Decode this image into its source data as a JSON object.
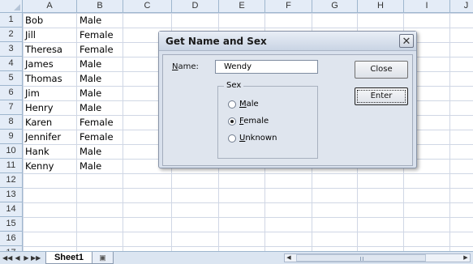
{
  "sheet": {
    "columns": [
      "A",
      "B",
      "C",
      "D",
      "E",
      "F",
      "G",
      "H",
      "I",
      "J"
    ],
    "rows": [
      "1",
      "2",
      "3",
      "4",
      "5",
      "6",
      "7",
      "8",
      "9",
      "10",
      "11",
      "12",
      "13",
      "14",
      "15",
      "16",
      "17"
    ],
    "data": [
      [
        "Bob",
        "Male"
      ],
      [
        "Jill",
        "Female"
      ],
      [
        "Theresa",
        "Female"
      ],
      [
        "James",
        "Male"
      ],
      [
        "Thomas",
        "Male"
      ],
      [
        "Jim",
        "Male"
      ],
      [
        "Henry",
        "Male"
      ],
      [
        "Karen",
        "Female"
      ],
      [
        "Jennifer",
        "Female"
      ],
      [
        "Hank",
        "Male"
      ],
      [
        "Kenny",
        "Male"
      ]
    ]
  },
  "tabbar": {
    "sheet_tab": "Sheet1",
    "nav_icons": [
      "first-sheet-icon",
      "prev-sheet-icon",
      "next-sheet-icon",
      "last-sheet-icon"
    ]
  },
  "dialog": {
    "title": "Get Name and Sex",
    "name_label": "Name:",
    "name_value": "Wendy",
    "sex_frame_label": "Sex",
    "options": [
      {
        "label": "Male",
        "selected": false
      },
      {
        "label": "Female",
        "selected": true
      },
      {
        "label": "Unknown",
        "selected": false
      }
    ],
    "close_label": "Close",
    "enter_label": "Enter"
  }
}
